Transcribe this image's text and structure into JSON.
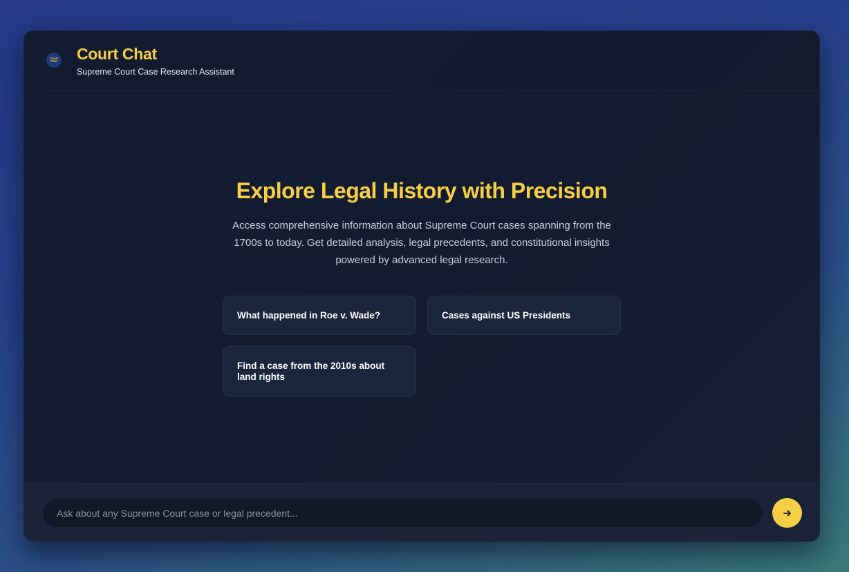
{
  "header": {
    "logo_text_top": "Court",
    "logo_text_bottom": "Chat",
    "title": "Court Chat",
    "subtitle": "Supreme Court Case Research Assistant"
  },
  "hero": {
    "title": "Explore Legal History with Precision",
    "description": "Access comprehensive information about Supreme Court cases spanning from the 1700s to today. Get detailed analysis, legal precedents, and constitutional insights powered by advanced legal research."
  },
  "suggestions": [
    {
      "label": "What happened in Roe v. Wade?"
    },
    {
      "label": "Cases against US Presidents"
    },
    {
      "label": "Find a case from the 2010s about land rights"
    }
  ],
  "input": {
    "placeholder": "Ask about any Supreme Court case or legal precedent...",
    "value": ""
  },
  "send_button": {
    "icon": "arrow-right-icon"
  },
  "colors": {
    "accent": "#f6cf45",
    "panel": "#141d34",
    "card": "#1b253b"
  }
}
